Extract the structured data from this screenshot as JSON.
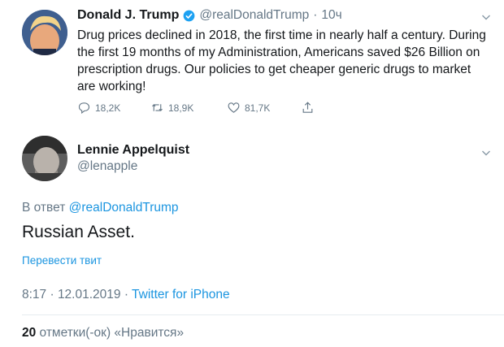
{
  "original_tweet": {
    "author_name": "Donald J. Trump",
    "handle": "@realDonaldTrump",
    "separator": "·",
    "time_ago": "10ч",
    "text": "Drug prices declined in 2018, the first time in nearly half a century. During the first 19 months of my Administration, Americans saved $26 Billion on prescription drugs. Our policies to get cheaper generic drugs to market are working!",
    "actions": {
      "replies": "18,2K",
      "retweets": "18,9K",
      "likes": "81,7K"
    }
  },
  "reply_tweet": {
    "author_name": "Lennie Appelquist",
    "handle": "@lenapple",
    "reply_prefix": "В ответ",
    "reply_to": "@realDonaldTrump",
    "text": "Russian Asset.",
    "translate_label": "Перевести твит",
    "timestamp": "8:17 · 12.01.2019 · ",
    "source": "Twitter for iPhone",
    "likes_count": "20",
    "likes_label": " отметки(-ок) «Нравится»"
  },
  "colors": {
    "link": "#1b95e0",
    "verified": "#1da1f2",
    "muted": "#657786"
  }
}
